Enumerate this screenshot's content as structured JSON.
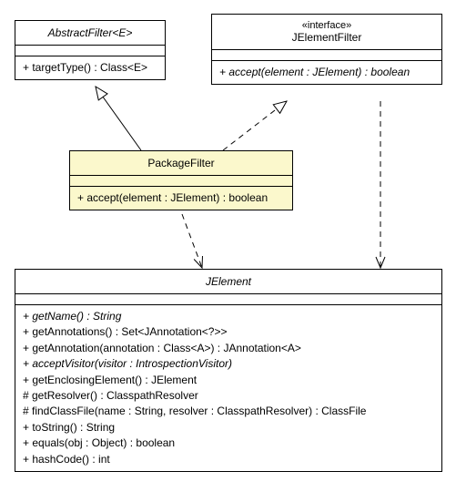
{
  "classes": {
    "abstractFilter": {
      "name": "AbstractFilter<E>",
      "ops": [
        "+ targetType() : Class<E>"
      ]
    },
    "jElementFilter": {
      "stereotype": "«interface»",
      "name": "JElementFilter",
      "ops": [
        "+ accept(element : JElement) : boolean"
      ]
    },
    "packageFilter": {
      "name": "PackageFilter",
      "ops": [
        "+ accept(element : JElement) : boolean"
      ]
    },
    "jElement": {
      "name": "JElement",
      "ops": [
        "+ getName() : String",
        "+ getAnnotations() : Set<JAnnotation<?>>",
        "+ getAnnotation(annotation : Class<A>) : JAnnotation<A>",
        "+ acceptVisitor(visitor : IntrospectionVisitor)",
        "+ getEnclosingElement() : JElement",
        "# getResolver() : ClasspathResolver",
        "# findClassFile(name : String, resolver : ClasspathResolver) : ClassFile",
        "+ toString() : String",
        "+ equals(obj : Object) : boolean",
        "+ hashCode() : int"
      ]
    }
  },
  "chart_data": {
    "type": "uml-class-diagram",
    "nodes": [
      {
        "id": "AbstractFilter",
        "title": "AbstractFilter<E>",
        "abstract": true,
        "operations": [
          "+ targetType() : Class<E>"
        ]
      },
      {
        "id": "JElementFilter",
        "title": "JElementFilter",
        "stereotype": "interface",
        "operations": [
          "+ accept(element : JElement) : boolean"
        ]
      },
      {
        "id": "PackageFilter",
        "title": "PackageFilter",
        "operations": [
          "+ accept(element : JElement) : boolean"
        ]
      },
      {
        "id": "JElement",
        "title": "JElement",
        "abstract": true,
        "operations": [
          "+ getName() : String",
          "+ getAnnotations() : Set<JAnnotation<?>>",
          "+ getAnnotation(annotation : Class<A>) : JAnnotation<A>",
          "+ acceptVisitor(visitor : IntrospectionVisitor)",
          "+ getEnclosingElement() : JElement",
          "# getResolver() : ClasspathResolver",
          "# findClassFile(name : String, resolver : ClasspathResolver) : ClassFile",
          "+ toString() : String",
          "+ equals(obj : Object) : boolean",
          "+ hashCode() : int"
        ]
      }
    ],
    "edges": [
      {
        "from": "PackageFilter",
        "to": "AbstractFilter",
        "kind": "generalization"
      },
      {
        "from": "PackageFilter",
        "to": "JElementFilter",
        "kind": "realization"
      },
      {
        "from": "PackageFilter",
        "to": "JElement",
        "kind": "dependency"
      },
      {
        "from": "JElementFilter",
        "to": "JElement",
        "kind": "dependency"
      }
    ]
  }
}
